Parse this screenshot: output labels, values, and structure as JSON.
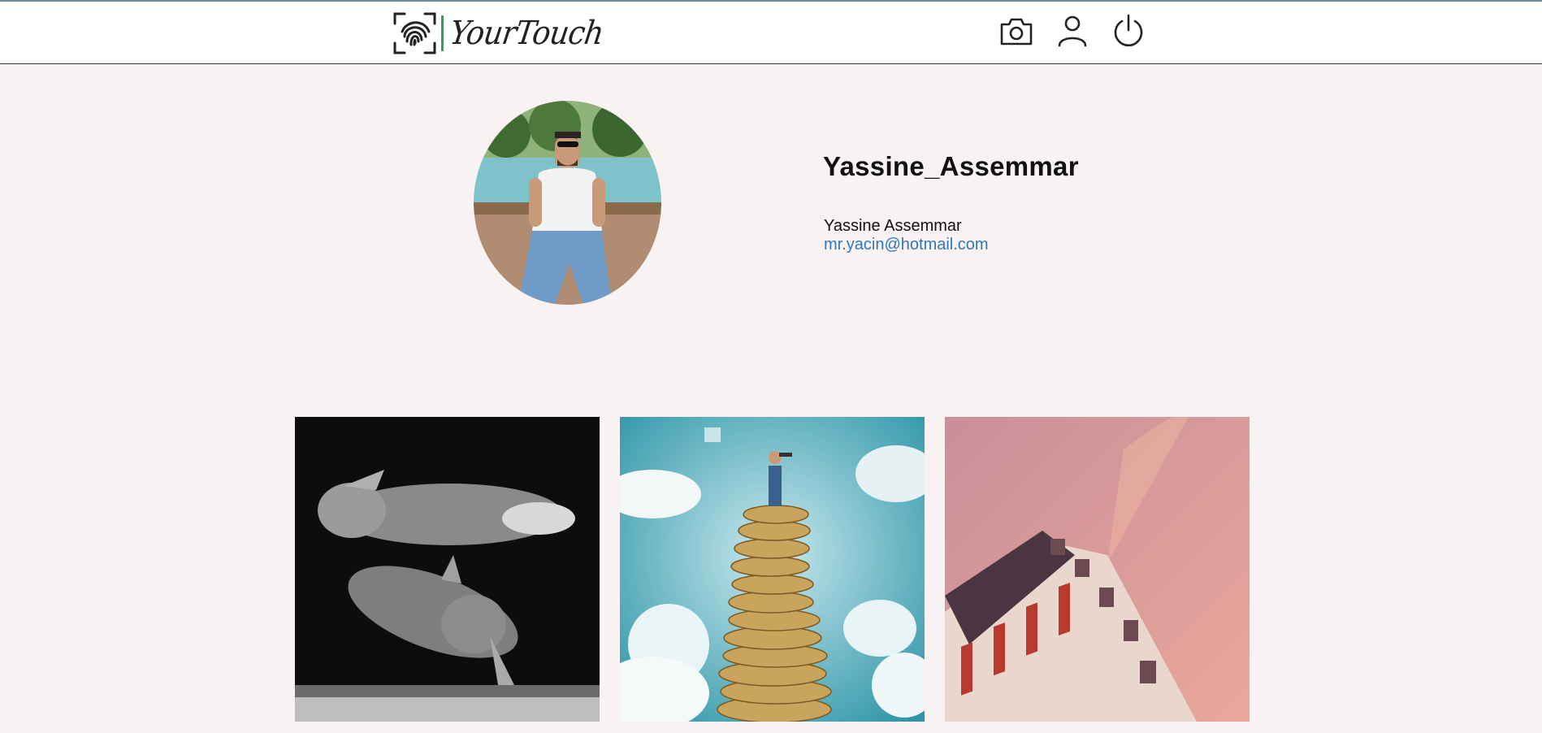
{
  "header": {
    "brand": "YourTouch",
    "icons": [
      "fingerprint-logo-icon",
      "camera-icon",
      "user-icon",
      "power-icon"
    ]
  },
  "profile": {
    "username": "Yassine_Assemmar",
    "full_name": "Yassine Assemmar",
    "email": "mr.yacin@hotmail.com"
  },
  "colors": {
    "page_bg": "#f8f2f2",
    "header_bg": "#ffffff",
    "accent_bar": "#2aa44f",
    "email_link": "#3377bb"
  },
  "posts": [
    {
      "subject": "rabbits-bw"
    },
    {
      "subject": "man-on-coin-stack"
    },
    {
      "subject": "building-pink-sky"
    }
  ]
}
